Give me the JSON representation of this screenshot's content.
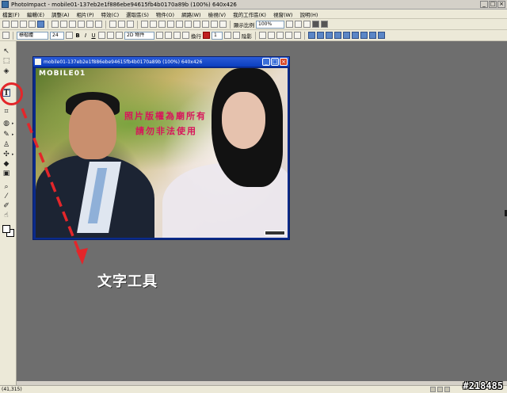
{
  "app": {
    "title": "PhotoImpact - mobile01-137eb2e1f886ebe94615fb4b0170a89b (100%) 640x426",
    "window_controls": [
      "_",
      "□",
      "×"
    ]
  },
  "menu": [
    "檔案(F)",
    "編輯(E)",
    "調整(A)",
    "相片(P)",
    "特效(C)",
    "選取區(S)",
    "物件(O)",
    "網路(W)",
    "檢視(V)",
    "我的工作區(K)",
    "視窗(W)",
    "說明(H)"
  ],
  "toolbar": {
    "zoom_label": "顯示比例",
    "zoom_value": "100%"
  },
  "text_toolbar": {
    "font_name": "標楷體",
    "font_size": "24",
    "bold": "B",
    "italic": "I",
    "underline": "U",
    "object_mode": "2D 物件",
    "wrap_label": "換行",
    "line_spacing": "1",
    "shadow_label": "陰影"
  },
  "document": {
    "title": "mobile01-137eb2e1f886ebe94615fb4b0170a89b (100%) 640x426",
    "logo_text": "MOBILE01",
    "watermark_line1": "照片版權為廟所有",
    "watermark_line2": "請勿非法使用"
  },
  "annotation": {
    "caption": "文字工具",
    "color": "#e3262a"
  },
  "status": {
    "coords": "(41,315)",
    "image_id": "#218485"
  },
  "tools": [
    {
      "name": "pick-tool",
      "glyph": "↖"
    },
    {
      "name": "transform-tool",
      "glyph": "⬚"
    },
    {
      "name": "paint-tool",
      "glyph": "◈"
    },
    {
      "name": "text-tool",
      "glyph": "T"
    },
    {
      "name": "crop-tool",
      "glyph": "⌗"
    },
    {
      "name": "fill-tool",
      "glyph": "◍"
    },
    {
      "name": "brush-tool",
      "glyph": "✎"
    },
    {
      "name": "stamp-tool",
      "glyph": "♙"
    },
    {
      "name": "clone-tool",
      "glyph": "✣"
    },
    {
      "name": "eraser-tool",
      "glyph": "◆"
    },
    {
      "name": "gradient-tool",
      "glyph": "▣"
    },
    {
      "name": "zoom-tool",
      "glyph": "⌕"
    },
    {
      "name": "eyedropper-tool",
      "glyph": "⁄"
    },
    {
      "name": "pen-tool",
      "glyph": "✐"
    },
    {
      "name": "hand-tool",
      "glyph": "☝"
    }
  ]
}
